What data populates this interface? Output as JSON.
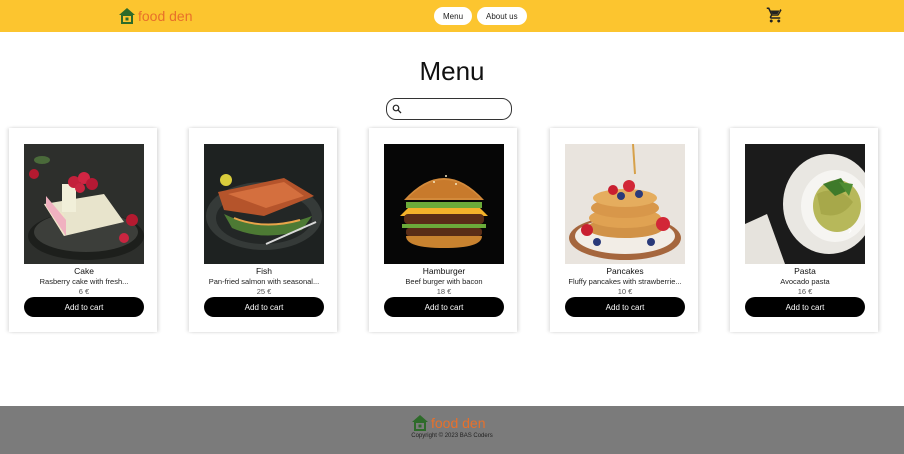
{
  "header": {
    "logo_text": "food den",
    "nav": [
      {
        "label": "Menu"
      },
      {
        "label": "About us"
      }
    ],
    "cart_icon": "shopping-cart-icon"
  },
  "main": {
    "title": "Menu",
    "search": {
      "value": "",
      "placeholder": "",
      "icon": "search-icon"
    },
    "items": [
      {
        "name": "Cake",
        "description": "Rasberry cake with fresh...",
        "price": "6 €",
        "button": "Add to cart"
      },
      {
        "name": "Fish",
        "description": "Pan-fried salmon with seasonal...",
        "price": "25 €",
        "button": "Add to cart"
      },
      {
        "name": "Hamburger",
        "description": "Beef burger with bacon",
        "price": "18 €",
        "button": "Add to cart"
      },
      {
        "name": "Pancakes",
        "description": "Fluffy pancakes with strawberrie...",
        "price": "10 €",
        "button": "Add to cart"
      },
      {
        "name": "Pasta",
        "description": "Avocado pasta",
        "price": "16 €",
        "button": "Add to cart"
      }
    ],
    "next_icon": "chevron-right-icon"
  },
  "footer": {
    "logo_text": "food den",
    "copyright": "Copyright © 2023 BAS Coders"
  },
  "colors": {
    "header_bg": "#fcc52f",
    "logo_text": "#e8702a",
    "logo_icon": "#2e6b2a",
    "button_bg": "#000000",
    "footer_bg": "#7b7b7b"
  }
}
